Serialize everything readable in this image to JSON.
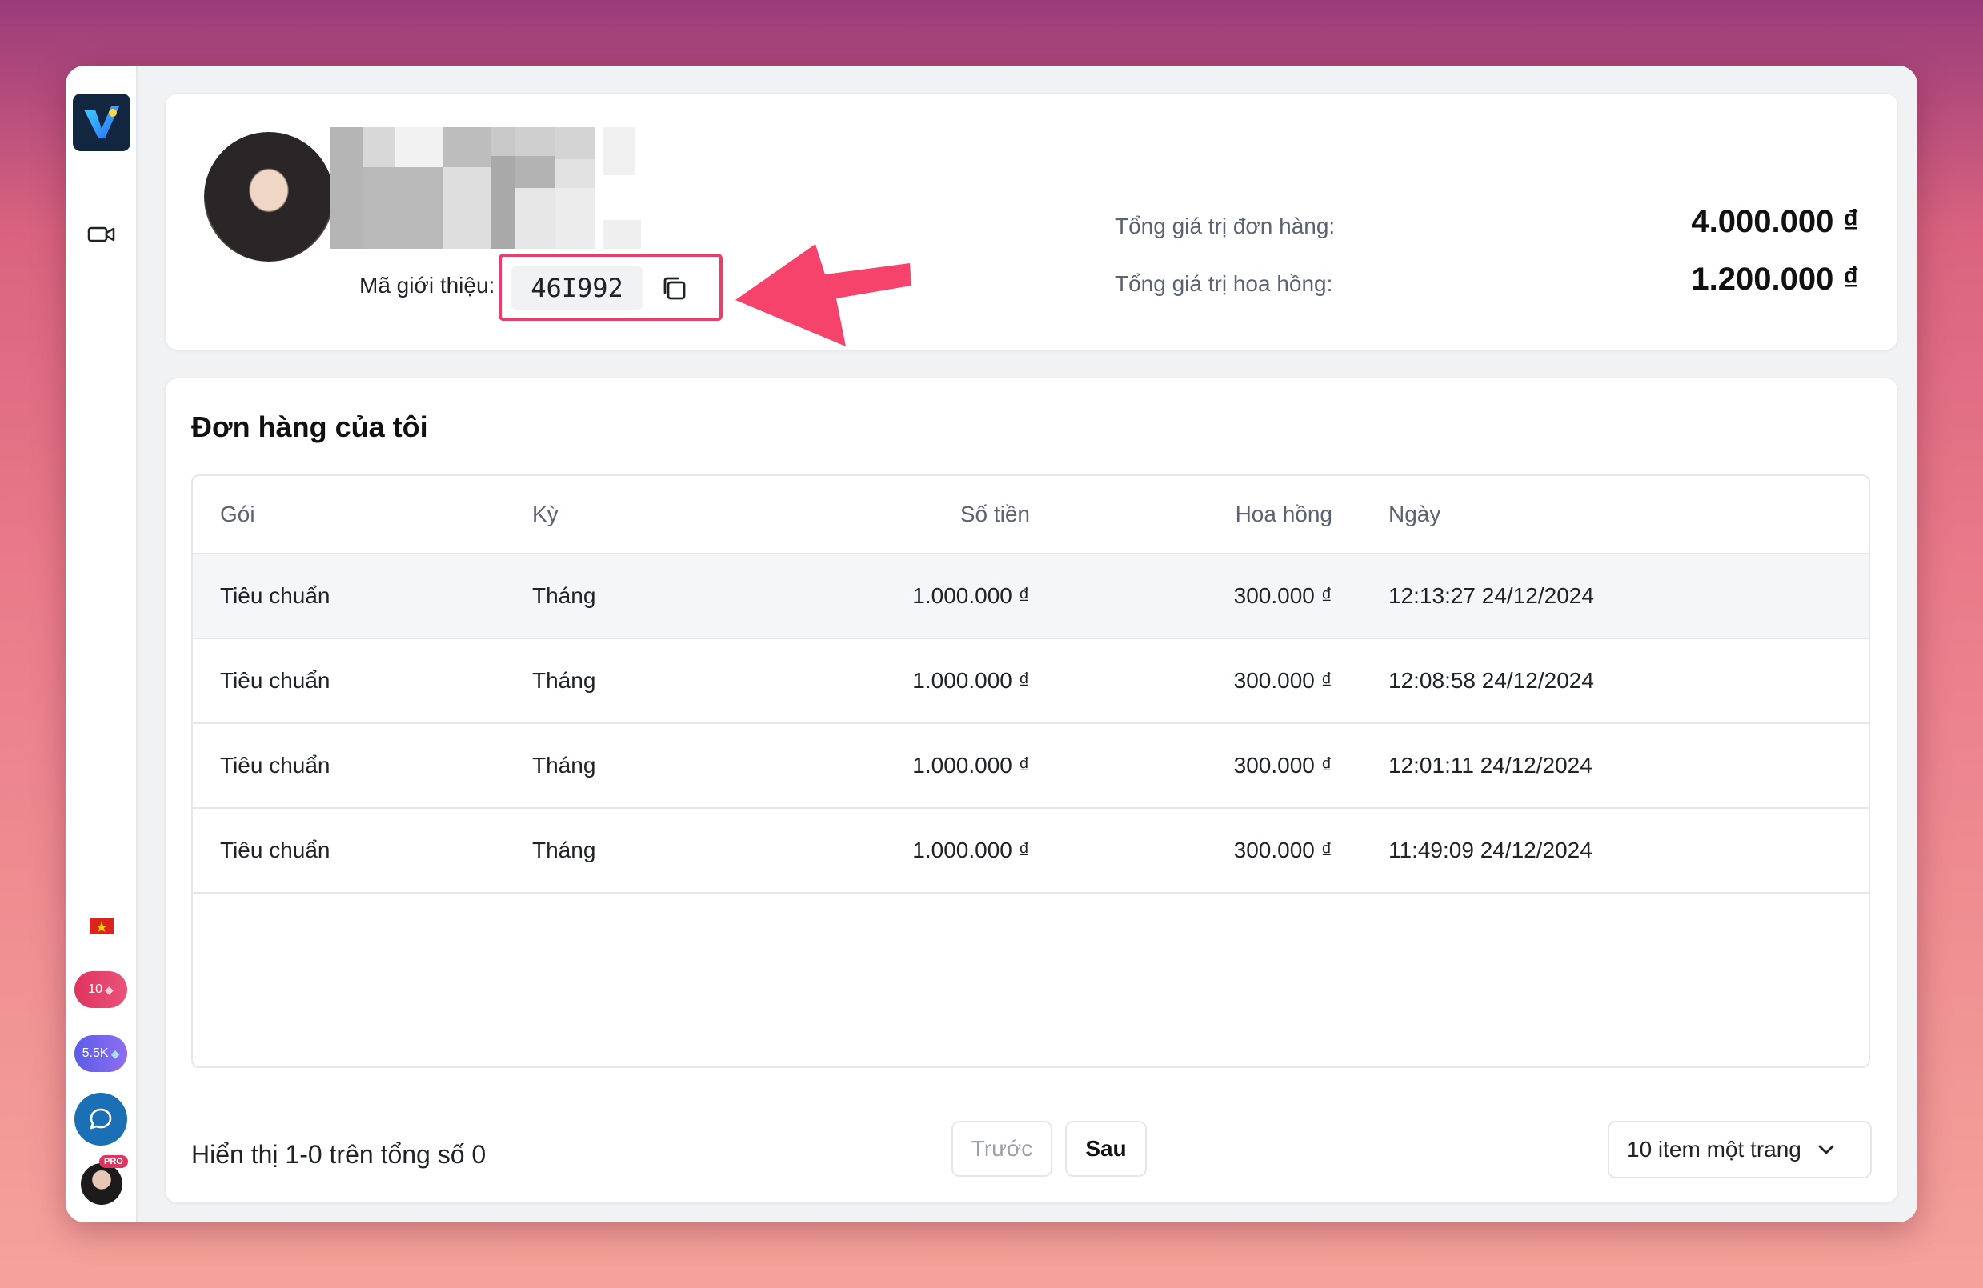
{
  "sidebar": {
    "icons": [
      "app-logo",
      "video-icon",
      "vietnam-flag-icon",
      "chat-icon"
    ],
    "credits": "10",
    "points": "5.5K",
    "pro_badge": "PRO"
  },
  "profile": {
    "referral_label": "Mã giới thiệu:",
    "referral_code": "46I992",
    "stats": [
      {
        "label": "Tổng giá trị đơn hàng:",
        "value": "4.000.000 ₫"
      },
      {
        "label": "Tổng giá trị hoa hồng:",
        "value": "1.200.000 ₫"
      }
    ]
  },
  "orders": {
    "title": "Đơn hàng của tôi",
    "columns": [
      "Gói",
      "Kỳ",
      "Số tiền",
      "Hoa hồng",
      "Ngày"
    ],
    "rows": [
      [
        "Tiêu chuẩn",
        "Tháng",
        "1.000.000 ₫",
        "300.000 ₫",
        "12:13:27 24/12/2024"
      ],
      [
        "Tiêu chuẩn",
        "Tháng",
        "1.000.000 ₫",
        "300.000 ₫",
        "12:08:58 24/12/2024"
      ],
      [
        "Tiêu chuẩn",
        "Tháng",
        "1.000.000 ₫",
        "300.000 ₫",
        "12:01:11 24/12/2024"
      ],
      [
        "Tiêu chuẩn",
        "Tháng",
        "1.000.000 ₫",
        "300.000 ₫",
        "11:49:09 24/12/2024"
      ]
    ],
    "footer": {
      "summary": "Hiển thị 1-0 trên tổng số 0",
      "prev": "Trước",
      "next": "Sau",
      "page_size": "10 item một trang"
    }
  },
  "colors": {
    "accent": "#e83e6b",
    "logo_bg": "#12263f",
    "chat": "#1a6fb5"
  }
}
